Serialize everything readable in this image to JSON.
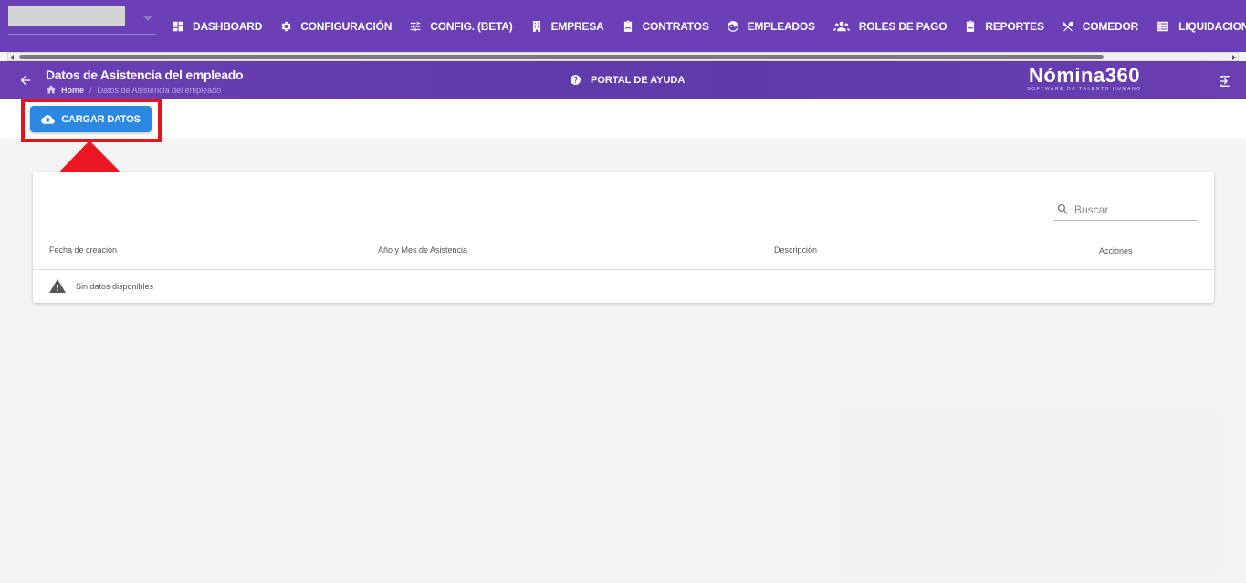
{
  "nav": {
    "items": [
      {
        "label": "DASHBOARD",
        "icon": "dashboard-icon"
      },
      {
        "label": "CONFIGURACIÓN",
        "icon": "gear-icon"
      },
      {
        "label": "CONFIG. (BETA)",
        "icon": "sliders-icon"
      },
      {
        "label": "EMPRESA",
        "icon": "building-icon"
      },
      {
        "label": "CONTRATOS",
        "icon": "clipboard-icon"
      },
      {
        "label": "EMPLEADOS",
        "icon": "face-icon"
      },
      {
        "label": "ROLES DE PAGO",
        "icon": "people-icon"
      },
      {
        "label": "REPORTES",
        "icon": "clipboard-icon"
      },
      {
        "label": "COMEDOR",
        "icon": "utensils-icon"
      },
      {
        "label": "LIQUIDACIONES",
        "icon": "list-icon"
      }
    ]
  },
  "header": {
    "title": "Datos de Asistencia del empleado",
    "breadcrumb": {
      "home": "Home",
      "separator": "/",
      "current": "Datos de Asistencia del empleado"
    },
    "help_label": "PORTAL DE AYUDA",
    "brand_name": "Nómina360",
    "brand_tagline": "SOFTWARE DE TALENTO HUMANO"
  },
  "actions": {
    "upload_label": "CARGAR DATOS"
  },
  "table": {
    "search_placeholder": "Buscar",
    "columns": [
      "Fecha de creación",
      "Año y Mes de Asistencia",
      "Descripción",
      "Acciones"
    ],
    "empty_text": "Sin datos disponibles"
  },
  "colors": {
    "nav_bg": "#6b3fb6",
    "button_bg": "#2c88e0",
    "highlight": "#e3131f"
  }
}
